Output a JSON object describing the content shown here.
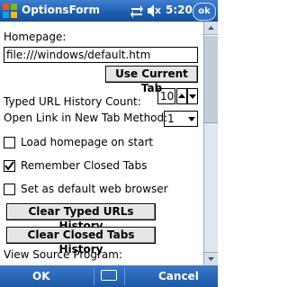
{
  "titlebar": {
    "title": "OptionsForm",
    "time": "5:20",
    "ok": "ok"
  },
  "form": {
    "homepage_label": "Homepage:",
    "homepage_value": "file:///windows/default.htm",
    "use_current_tab": "Use Current Tab",
    "history_count_label": "Typed URL History Count:",
    "history_count_value": "10",
    "open_link_label": "Open Link in New Tab Method:",
    "open_link_value": "1",
    "checkboxes": [
      {
        "label": "Load homepage on start",
        "checked": false
      },
      {
        "label": "Remember Closed Tabs",
        "checked": true
      },
      {
        "label": "Set as default web browser",
        "checked": false
      }
    ],
    "clear_typed_urls": "Clear Typed URLs History",
    "clear_closed_tabs": "Clear Closed Tabs History",
    "view_source_label": "View Source Program:"
  },
  "menubar": {
    "left": "OK",
    "right": "Cancel"
  }
}
